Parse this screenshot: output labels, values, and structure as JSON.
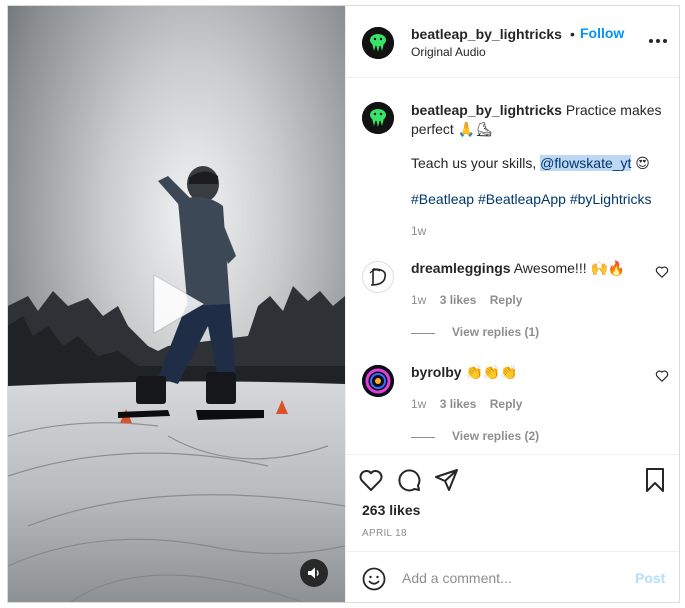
{
  "post": {
    "username": "beatleap_by_lightricks",
    "follow_label": "Follow",
    "separator": "•",
    "audio_label": "Original Audio",
    "caption_text": "Practice makes perfect 🙏⛸",
    "caption_line2_prefix": "Teach us your skills, ",
    "caption_mention": "@flowskate_yt",
    "caption_line2_suffix": " 😍",
    "hashtags": [
      "#Beatleap",
      "#BeatleapApp",
      "#byLightricks"
    ],
    "caption_time": "1w",
    "likes": "263 likes",
    "date": "APRIL 18"
  },
  "comments": [
    {
      "username": "dreamleggings",
      "text": "Awesome!!! 🙌🔥",
      "time": "1w",
      "likes": "3 likes",
      "reply_label": "Reply",
      "view_replies": "View replies (1)"
    },
    {
      "username": "byrolby",
      "text": "👏👏👏",
      "time": "1w",
      "likes": "3 likes",
      "reply_label": "Reply",
      "view_replies": "View replies (2)"
    }
  ],
  "add_comment": {
    "placeholder": "Add a comment...",
    "post_label": "Post"
  },
  "colors": {
    "link_blue": "#0095f6",
    "tag_blue": "#00376b",
    "muted": "#8e8e8e",
    "post_disabled": "#b2dffc"
  },
  "icons": [
    "play-icon",
    "volume-icon",
    "more-icon",
    "heart-icon",
    "comment-icon",
    "share-icon",
    "bookmark-icon",
    "emoji-icon"
  ]
}
